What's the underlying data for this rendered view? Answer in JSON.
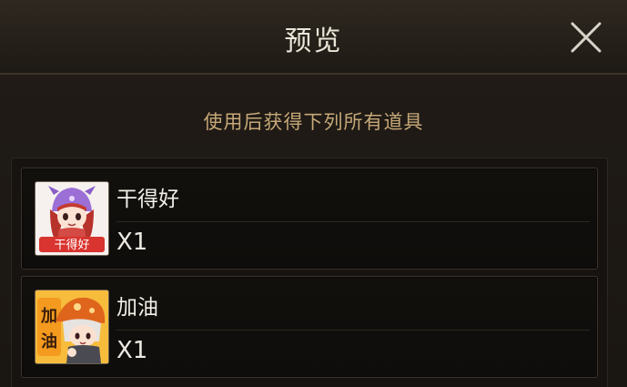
{
  "dialog": {
    "title": "预览",
    "subtitle": "使用后获得下列所有道具"
  },
  "items": [
    {
      "name": "干得好",
      "quantity": "X1",
      "icon": "emote-good-job-icon",
      "icon_text": "干得好"
    },
    {
      "name": "加油",
      "quantity": "X1",
      "icon": "emote-cheer-icon",
      "icon_text": "加油"
    }
  ],
  "colors": {
    "title": "#ebe6d8",
    "subtitle": "#c5a878",
    "panel_bg": "#1a1611",
    "item_border": "#3b342a"
  }
}
